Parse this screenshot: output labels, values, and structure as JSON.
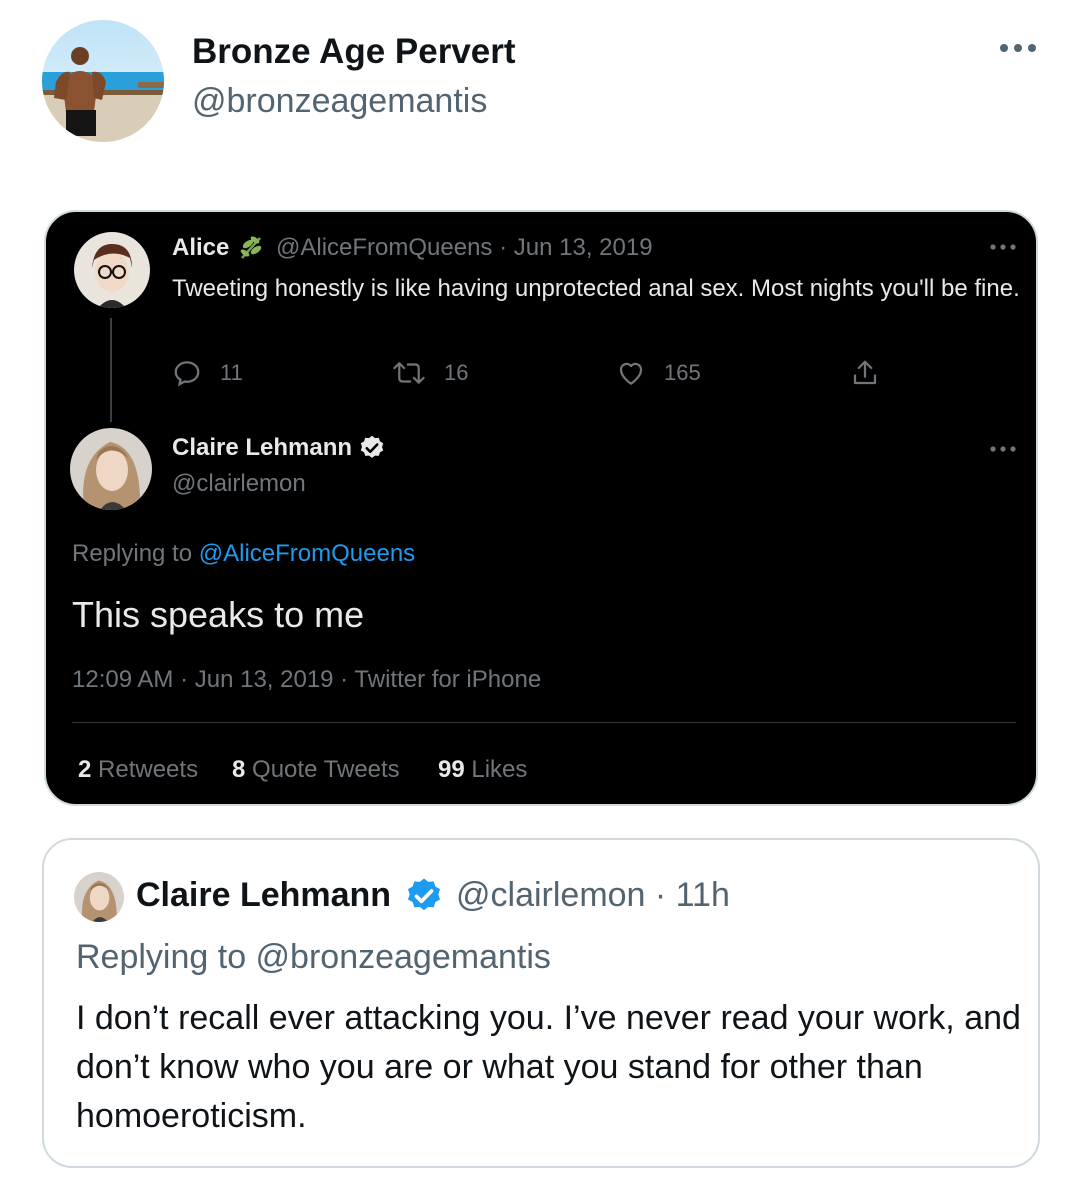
{
  "author": {
    "name": "Bronze Age Pervert",
    "handle": "@bronzeagemantis"
  },
  "screenshot": {
    "parent_tweet": {
      "name": "Alice",
      "handle": "@AliceFromQueens",
      "date": "Jun 13, 2019",
      "text": "Tweeting honestly is like having unprotected anal sex. Most nights you'll be fine.",
      "replies": "11",
      "retweets": "16",
      "likes": "165"
    },
    "reply_tweet": {
      "name": "Claire Lehmann",
      "handle": "@clairlemon",
      "replying_label": "Replying to",
      "replying_to": "@AliceFromQueens",
      "text": "This speaks to me",
      "timestamp": "12:09 AM · Jun 13, 2019 · Twitter for iPhone",
      "retweets_count": "2",
      "retweets_label": "Retweets",
      "quotes_count": "8",
      "quotes_label": "Quote Tweets",
      "likes_count": "99",
      "likes_label": "Likes"
    }
  },
  "quoted_tweet": {
    "name": "Claire Lehmann",
    "handle_time": "@clairlemon · 11h",
    "replying": "Replying to @bronzeagemantis",
    "text": "I don’t recall ever attacking you. I’ve never read your work, and don’t know who you are or what you stand for other than homoeroticism."
  },
  "colors": {
    "verified": "#1d9bf0",
    "secondary_text": "#536471",
    "dark_background": "#000000"
  }
}
